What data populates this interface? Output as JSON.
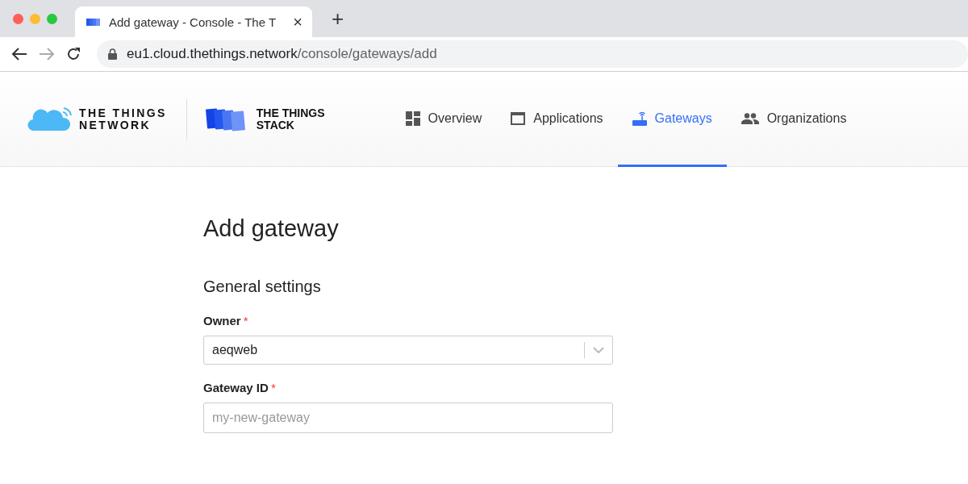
{
  "browser": {
    "tab": {
      "title": "Add gateway - Console - The T",
      "close": "×",
      "selected": true
    },
    "new_tab": "+",
    "address": {
      "host": "eu1.cloud.thethings.network",
      "path": "/console/gateways/add"
    }
  },
  "header": {
    "logos": [
      {
        "kind": "network",
        "line1": "THE THINGS",
        "line2": "NETWORK"
      },
      {
        "kind": "stack",
        "line1": "THE THINGS",
        "line2": "STACK"
      }
    ],
    "nav": [
      {
        "label": "Overview",
        "kind": "overview",
        "selected": false
      },
      {
        "label": "Applications",
        "kind": "applications",
        "selected": false
      },
      {
        "label": "Gateways",
        "kind": "gateways",
        "selected": true
      },
      {
        "label": "Organizations",
        "kind": "organizations",
        "selected": false
      }
    ]
  },
  "page": {
    "title": "Add gateway",
    "section": "General settings",
    "fields": [
      {
        "kind": "select",
        "label": "Owner",
        "required_mark": "*",
        "value": "aeqweb"
      },
      {
        "kind": "text",
        "label": "Gateway ID",
        "required_mark": "*",
        "placeholder": "my-new-gateway"
      }
    ]
  }
}
